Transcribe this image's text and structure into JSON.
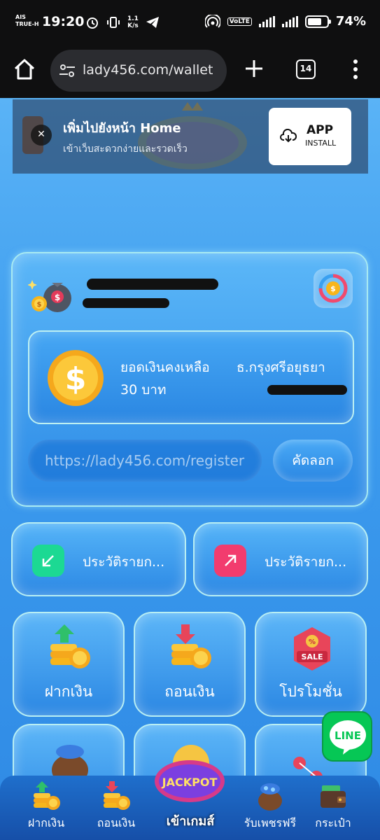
{
  "status_bar": {
    "carrier_line1": "AIS",
    "carrier_line2": "TRUE-H",
    "time": "19:20",
    "speed_value": "1.1",
    "speed_unit": "K/s",
    "volte": "VoLTE",
    "network": "4G+",
    "battery_percent": "74%",
    "battery_level": 0.74
  },
  "browser": {
    "url": "lady456.com/wallet",
    "tab_count": "14"
  },
  "install_banner": {
    "title": "เพิ่มไปยังหน้า Home",
    "subtitle": "เข้าเว็บสะดวกง่ายและรวดเร็ว",
    "button_main": "APP",
    "button_sub": "INSTALL"
  },
  "wallet": {
    "balance_label": "ยอดเงินคงเหลือ",
    "balance_value": "30 บาท",
    "bank_name": "ธ.กรุงศรีอยุธยา",
    "referral_link": "https://lady456.com/register",
    "copy_label": "คัดลอก"
  },
  "history": {
    "deposit_history_label": "ประวัติรายก...",
    "withdraw_history_label": "ประวัติรายก..."
  },
  "menu": {
    "items": [
      {
        "label": "ฝากเงิน",
        "icon": "deposit-coins-icon"
      },
      {
        "label": "ถอนเงิน",
        "icon": "withdraw-coins-icon"
      },
      {
        "label": "โปรโมชั่น",
        "icon": "sale-tag-icon"
      }
    ]
  },
  "floating": {
    "line_label": "LINE"
  },
  "bottom_nav": {
    "items": [
      {
        "label": "ฝากเงิน",
        "icon": "deposit-coins-icon"
      },
      {
        "label": "ถอนเงิน",
        "icon": "withdraw-coins-icon"
      },
      {
        "label": "เข้าเกมส์",
        "icon": "jackpot-icon"
      },
      {
        "label": "รับเพชรฟรี",
        "icon": "gem-bag-icon"
      },
      {
        "label": "กระเป๋า",
        "icon": "wallet-icon"
      }
    ],
    "jackpot_text": "JACKPOT"
  },
  "colors": {
    "accent": "#3c9df0",
    "deposit_icon_bg": "#1cd993",
    "withdraw_icon_bg": "#f23c6e",
    "line_green": "#06c755"
  }
}
